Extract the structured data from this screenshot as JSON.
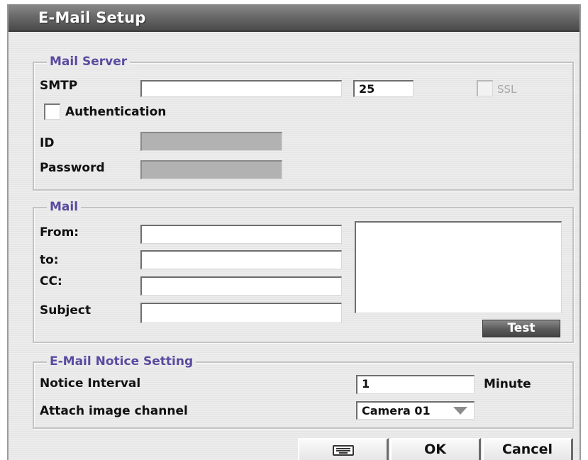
{
  "dialog": {
    "title": "E-Mail Setup"
  },
  "mail_server": {
    "legend": "Mail Server",
    "smtp_label": "SMTP",
    "smtp_value": "",
    "port_value": "25",
    "ssl_label": "SSL",
    "ssl_checked": false,
    "ssl_enabled": false,
    "authentication_label": "Authentication",
    "authentication_checked": false,
    "id_label": "ID",
    "id_value": "",
    "password_label": "Password",
    "password_value": ""
  },
  "mail": {
    "legend": "Mail",
    "from_label": "From:",
    "from_value": "",
    "to_label": "to:",
    "to_value": "",
    "cc_label": "CC:",
    "cc_value": "",
    "subject_label": "Subject",
    "subject_value": "",
    "body_value": "",
    "test_button_label": "Test"
  },
  "notice": {
    "legend": "E-Mail Notice Setting",
    "interval_label": "Notice Interval",
    "interval_value": "1",
    "interval_unit": "Minute",
    "attach_label": "Attach image channel",
    "attach_value": "Camera 01"
  },
  "buttons": {
    "keyboard_icon": "keyboard-icon",
    "ok_label": "OK",
    "cancel_label": "Cancel"
  }
}
